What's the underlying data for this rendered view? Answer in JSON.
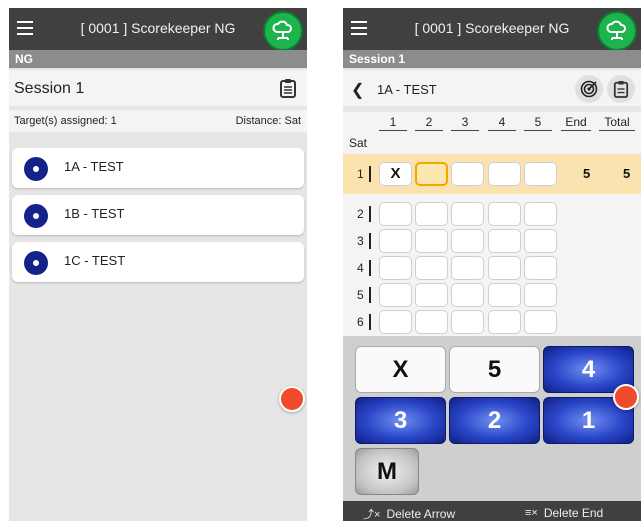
{
  "app": {
    "title": "[ 0001 ] Scorekeeper NG"
  },
  "left": {
    "subbar": "NG",
    "session_title": "Session 1",
    "targets_assigned": "Target(s) assigned: 1",
    "distance": "Distance: Sat",
    "targets": [
      {
        "label": "1A - TEST"
      },
      {
        "label": "1B - TEST"
      },
      {
        "label": "1C - TEST"
      }
    ]
  },
  "right": {
    "subbar": "Session 1",
    "target_name": "1A - TEST",
    "columns": [
      "1",
      "2",
      "3",
      "4",
      "5",
      "End",
      "Total"
    ],
    "distance_label": "Sat",
    "rows": [
      {
        "num": "1",
        "arrows": [
          "X",
          "",
          "",
          "",
          ""
        ],
        "end": "5",
        "total": "5"
      },
      {
        "num": "2",
        "arrows": [
          "",
          "",
          "",
          "",
          ""
        ],
        "end": "",
        "total": ""
      },
      {
        "num": "3",
        "arrows": [
          "",
          "",
          "",
          "",
          ""
        ],
        "end": "",
        "total": ""
      },
      {
        "num": "4",
        "arrows": [
          "",
          "",
          "",
          "",
          ""
        ],
        "end": "",
        "total": ""
      },
      {
        "num": "5",
        "arrows": [
          "",
          "",
          "",
          "",
          ""
        ],
        "end": "",
        "total": ""
      },
      {
        "num": "6",
        "arrows": [
          "",
          "",
          "",
          "",
          ""
        ],
        "end": "",
        "total": ""
      }
    ],
    "keys": [
      {
        "label": "X",
        "style": "white"
      },
      {
        "label": "5",
        "style": "white"
      },
      {
        "label": "4",
        "style": "blue"
      },
      {
        "label": "3",
        "style": "blue"
      },
      {
        "label": "2",
        "style": "blue"
      },
      {
        "label": "1",
        "style": "blue"
      },
      {
        "label": "M",
        "style": "grey"
      }
    ],
    "delete_arrow": "Delete Arrow",
    "delete_end": "Delete End"
  },
  "colors": {
    "topbar": "#404040",
    "accent_green": "#1db34d",
    "target_blue": "#13238a",
    "highlight": "#fbe3b0",
    "fab": "#f04a2a"
  }
}
